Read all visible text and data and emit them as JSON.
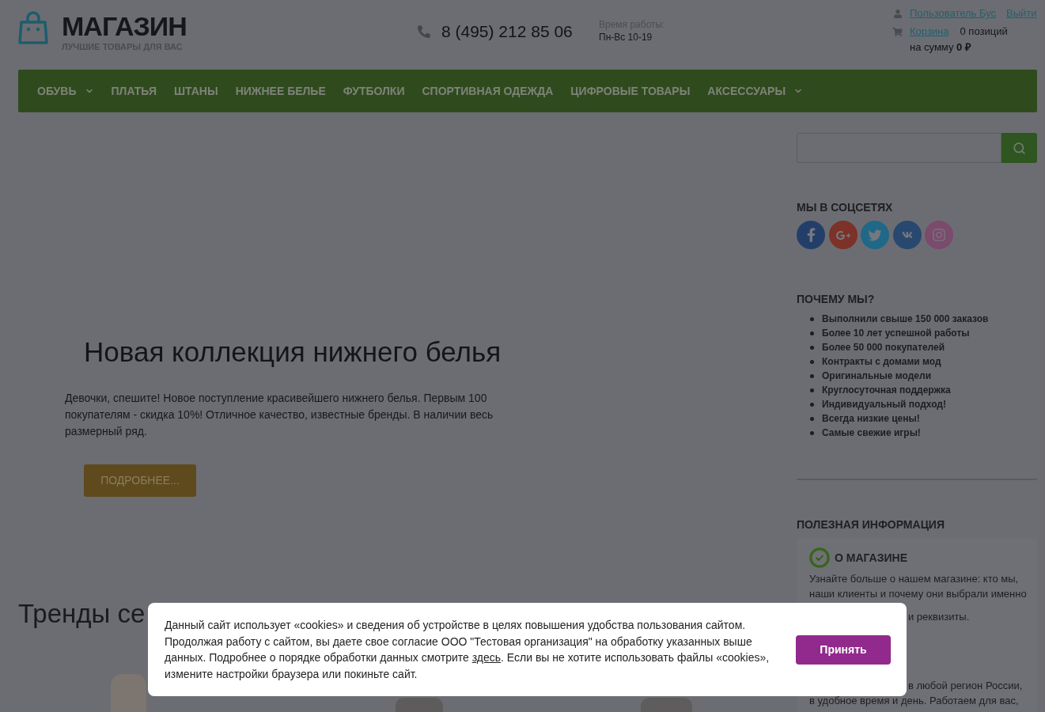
{
  "header": {
    "logo": {
      "name": "МАГАЗИН",
      "tagline": "ЛУЧШИЕ ТОВАРЫ ДЛЯ ВАС"
    },
    "phone": "8 (495) 212 85 06",
    "hours": {
      "label": "Время работы:",
      "value": "Пн-Вс 10-19"
    },
    "account": {
      "user_link": "Пользователь Бус",
      "logout_link": "Выйти",
      "cart_link": "Корзина",
      "cart_count": "0 позиций",
      "cart_total": "на сумму **0 ₽**"
    }
  },
  "nav": {
    "items": [
      {
        "label": "ОБУВЬ",
        "has_submenu": true
      },
      {
        "label": "ПЛАТЬЯ",
        "has_submenu": false
      },
      {
        "label": "ШТАНЫ",
        "has_submenu": false
      },
      {
        "label": "НИЖНЕЕ БЕЛЬЕ",
        "has_submenu": false
      },
      {
        "label": "ФУТБОЛКИ",
        "has_submenu": false
      },
      {
        "label": "СПОРТИВНАЯ ОДЕЖДА",
        "has_submenu": false
      },
      {
        "label": "ЦИФРОВЫЕ ТОВАРЫ",
        "has_submenu": false
      },
      {
        "label": "АКСЕССУАРЫ",
        "has_submenu": true
      }
    ]
  },
  "hero": {
    "title": "Новая коллекция нижнего белья",
    "text": "Девочки, спешите! Новое поступление красивейшего нижнего белья. Первым 100 покупателям - скидка 10%! Отличное качество, известные бренды. В наличии весь размерный ряд.",
    "button": "ПОДРОБНЕЕ..."
  },
  "trends": {
    "title": "Тренды се"
  },
  "sidebar": {
    "social": {
      "title": "МЫ В СОЦСЕТЯХ",
      "networks": [
        {
          "kind": "facebook",
          "color": "#233f69"
        },
        {
          "kind": "google_plus",
          "color": "#7c3129"
        },
        {
          "kind": "twitter",
          "color": "#206888"
        },
        {
          "kind": "vk",
          "color": "#29486f"
        },
        {
          "kind": "instagram",
          "color": "#7b4a6d"
        }
      ]
    },
    "why_us": {
      "title": "ПОЧЕМУ МЫ?",
      "items": [
        "Выполнили свыше 150 000 заказов",
        "Более 10 лет успешной работы",
        "Более 50 000 покупателей",
        "Контракты с домами мод",
        "Оригинальные модели",
        "Круглосуточная поддержка",
        "Индивидуальный подход!",
        "Всегда низкие цены!",
        "Самые свежие игры!"
      ]
    },
    "useful_info": {
      "title": "ПОЛЕЗНАЯ ИНФОРМАЦИЯ",
      "blocks": [
        {
          "heading": "О МАГАЗИНЕ",
          "lines": [
            {
              "kind": "full",
              "text": "Узнайте больше о нашем магазине: кто мы,"
            },
            {
              "kind": "full",
              "text": "наши клиенты и почему они выбрали именно"
            },
            {
              "kind": "partial",
              "text": "и реквизиты."
            }
          ]
        },
        {
          "lines": [
            {
              "kind": "partial",
              "text": "в любой регион России,"
            },
            {
              "kind": "full",
              "text": "в удобное время и день. Работаем для вас,"
            }
          ]
        }
      ]
    }
  },
  "cookie_banner": {
    "text_before": "Данный сайт использует «cookies» и сведения об устройстве в целях повышения удобства пользования сайтом. Продолжая работу с сайтом, вы даете свое согласие ООО \"Тестовая организация\" на обработку указанных выше данных. Подробнее о порядке обработки данных смотрите ",
    "link": "здесь",
    "text_after": ". Если вы не хотите использовать файлы «cookies», измените настройки браузера или покиньте сайт.",
    "button": "Принять"
  }
}
